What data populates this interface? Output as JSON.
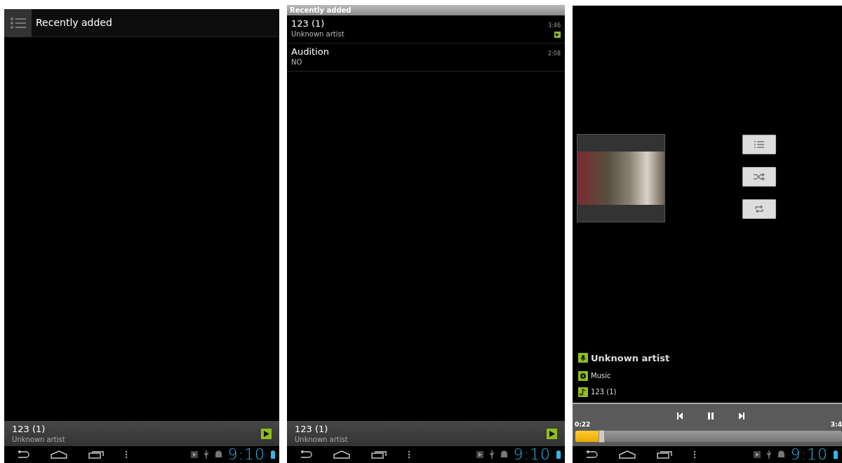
{
  "screens": [
    {
      "kind": "library",
      "header": {
        "title": "Recently added"
      },
      "now_playing": {
        "title": "123 (1)",
        "artist": "Unknown artist"
      },
      "nav_bar": {
        "clock": "9:10"
      }
    },
    {
      "kind": "list",
      "section_header": "Recently added",
      "tracks": [
        {
          "title": "123 (1)",
          "artist": "Unknown artist",
          "duration": "3:46",
          "playing": true
        },
        {
          "title": "Audition",
          "artist": "NO",
          "duration": "2:08",
          "playing": false
        }
      ],
      "now_playing": {
        "title": "123 (1)",
        "artist": "Unknown artist"
      },
      "nav_bar": {
        "clock": "9:10"
      }
    },
    {
      "kind": "player",
      "info": [
        {
          "kind": "artist",
          "text": "Unknown artist"
        },
        {
          "kind": "album",
          "text": "Music"
        },
        {
          "kind": "track",
          "text": "123 (1)"
        }
      ],
      "elapsed": "0:22",
      "total": "3:4",
      "progress": {
        "level": 0.1
      },
      "nav_bar": {
        "clock": "9:10"
      }
    }
  ]
}
